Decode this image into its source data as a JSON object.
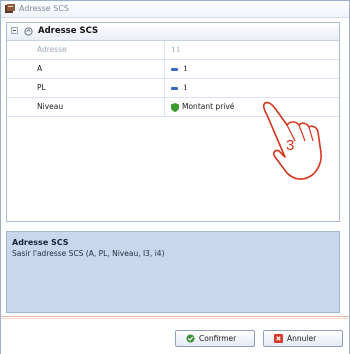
{
  "window": {
    "title": "Adresse SCS"
  },
  "grid": {
    "category_label": "Adresse SCS",
    "rows": [
      {
        "name": "Adresse",
        "value": "11",
        "icon": "",
        "enabled": false
      },
      {
        "name": "A",
        "value": "1",
        "icon": "number-icon",
        "enabled": true
      },
      {
        "name": "PL",
        "value": "1",
        "icon": "number-icon",
        "enabled": true
      },
      {
        "name": "Niveau",
        "value": "Montant privé",
        "icon": "shield-icon",
        "enabled": true
      }
    ]
  },
  "description": {
    "title": "Adresse SCS",
    "text": "Sasir l'adresse SCS (A, PL, Niveau, I3, i4)"
  },
  "buttons": {
    "confirm_label": "Confirmer",
    "cancel_label": "Annuler"
  },
  "callout": {
    "step_number": "3"
  },
  "colors": {
    "accent": "#d4351c",
    "description_bg": "#c9d7ec",
    "border": "#a9bcd6"
  }
}
